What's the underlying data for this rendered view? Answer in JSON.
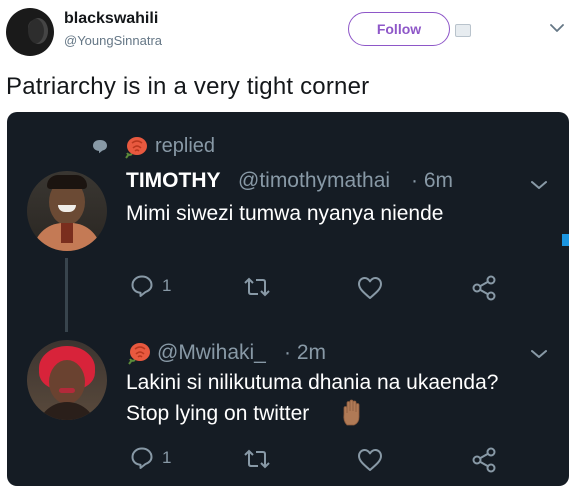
{
  "header": {
    "display_name": "blackswahili",
    "handle": "@YoungSinnatra",
    "follow_label": "Follow"
  },
  "tweet": {
    "text": "Patriarchy is in a very tight corner"
  },
  "card": {
    "replied_label": "replied",
    "reply1": {
      "name": "TIMOTHY",
      "handle": "@timothymathai",
      "time": "· 6m",
      "text": "Mimi siwezi tumwa nyanya niende",
      "reply_count": "1"
    },
    "reply2": {
      "handle": "@Mwihaki_",
      "time": "· 2m",
      "line1": "Lakini si nilikutuma dhania na ukaenda?",
      "line2": "Stop lying on twitter",
      "reply_count": "1"
    }
  },
  "colors": {
    "accent_purple": "#8e57c8",
    "card_bg": "#151c24",
    "muted": "#8899a6",
    "rose": "#e8593f"
  },
  "icons": [
    "chevron-down-icon",
    "speech-bubble-icon",
    "rose-emoji-icon",
    "reply-icon",
    "retweet-icon",
    "like-icon",
    "share-icon",
    "raised-hand-emoji-icon"
  ]
}
